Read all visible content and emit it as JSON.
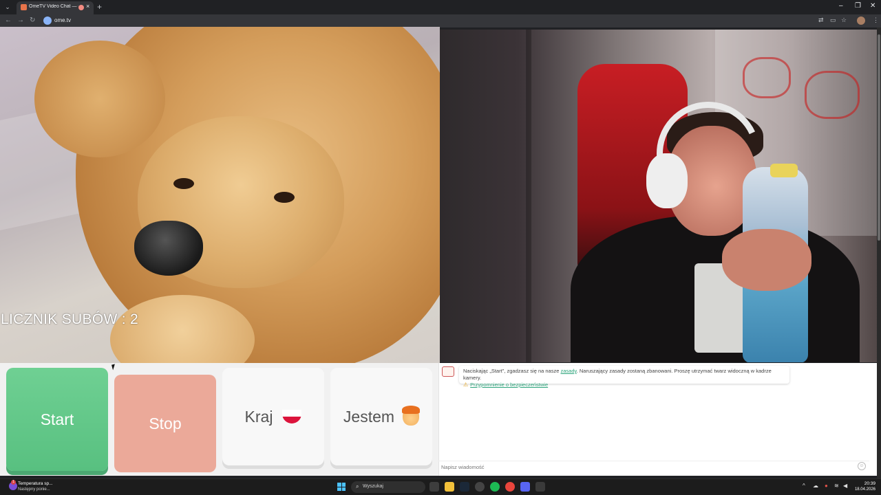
{
  "browser": {
    "tab_title": "OmeTV Video Chat — Ome",
    "tab_close": "×",
    "new_tab": "+",
    "url": "ome.tv",
    "window_controls": [
      "–",
      "❐",
      "✕"
    ]
  },
  "video": {
    "overlay_text": "LICZNIK SUBÓW : 2"
  },
  "controls": {
    "start_label": "Start",
    "stop_label": "Stop",
    "country_label": "Kraj",
    "country_flag": "poland-flag",
    "gender_label": "Jestem",
    "gender_icon": "boy-emoji",
    "start_color": "#5fc586",
    "stop_color": "#eba999"
  },
  "chat": {
    "notice_prefix": "Naciskając „Start\", zgadzasz się na nasze",
    "notice_link": "zasady",
    "notice_suffix": ". Naruszający zasady zostaną zbanowani. Proszę utrzymać twarz widoczną w kadrze kamery.",
    "safety_link": "Przypomnienie o bezpieczeństwie",
    "input_placeholder": "Napisz wiadomość",
    "link_color": "#2aa37a"
  },
  "taskbar": {
    "weather_title": "Temperatura sp...",
    "weather_subtitle": "Następny ponie...",
    "weather_badge": "1",
    "search_label": "Wyszukaj",
    "time": "20:39",
    "date": "18.04.2026"
  }
}
